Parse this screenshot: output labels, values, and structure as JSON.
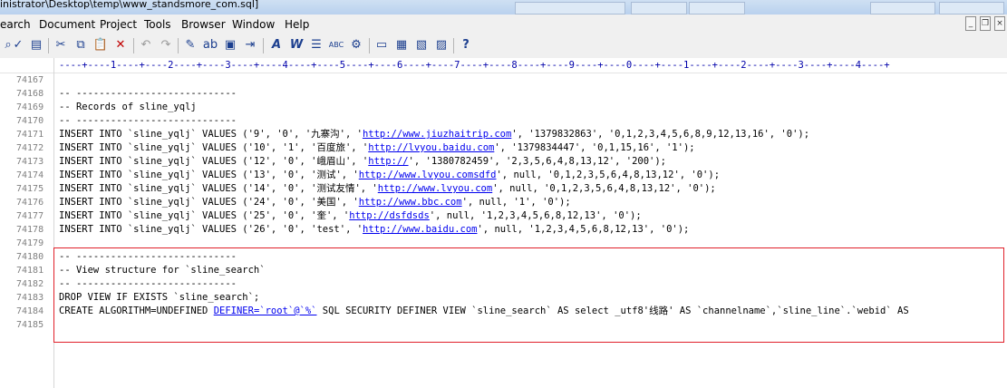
{
  "window": {
    "title": "inistrator\\Desktop\\temp\\www_standsmore_com.sql]"
  },
  "menu": [
    "earch",
    "Document",
    "Project",
    "Tools",
    "Browser",
    "Window",
    "Help"
  ],
  "toolbar": {
    "icons": [
      "search-icon",
      "spellcheck-icon",
      "reference-icon",
      "cut-icon",
      "copy-icon",
      "paste-icon",
      "delete-icon",
      "undo-icon",
      "redo-icon",
      "find-icon",
      "replace-icon",
      "find-in-files-icon",
      "code-list-icon",
      "format-italic-icon",
      "format-w-icon",
      "list-icon",
      "abc-icon",
      "tools-icon",
      "panel1-icon",
      "panel2-icon",
      "panel3-icon",
      "panel4-icon",
      "help-icon"
    ]
  },
  "editor": {
    "ruler": "----+----1----+----2----+----3----+----4----+----5----+----6----+----7----+----8----+----9----+----0----+----1----+----2----+----3----+----4----+",
    "lines": [
      {
        "num": "74167",
        "text": ""
      },
      {
        "num": "74168",
        "text": "-- ----------------------------"
      },
      {
        "num": "74169",
        "text": "-- Records of sline_yqlj"
      },
      {
        "num": "74170",
        "text": "-- ----------------------------"
      },
      {
        "num": "74171",
        "text": "INSERT INTO `sline_yqlj` VALUES ('9', '0', '九寨沟', '",
        "link": "http://www.jiuzhaitrip.com",
        "text2": "', '1379832863', '0,1,2,3,4,5,6,8,9,12,13,16', '0');"
      },
      {
        "num": "74172",
        "text": "INSERT INTO `sline_yqlj` VALUES ('10', '1', '百度旅', '",
        "link": "http://lvyou.baidu.com",
        "text2": "', '1379834447', '0,1,15,16', '1');"
      },
      {
        "num": "74173",
        "text": "INSERT INTO `sline_yqlj` VALUES ('12', '0', '峨眉山', '",
        "link": "http://",
        "text2": "', '1380782459', '2,3,5,6,4,8,13,12', '200');"
      },
      {
        "num": "74174",
        "text": "INSERT INTO `sline_yqlj` VALUES ('13', '0', '测试', '",
        "link": "http://www.lvyou.comsdfd",
        "text2": "', null, '0,1,2,3,5,6,4,8,13,12', '0');"
      },
      {
        "num": "74175",
        "text": "INSERT INTO `sline_yqlj` VALUES ('14', '0', '测试友情', '",
        "link": "http://www.lvyou.com",
        "text2": "', null, '0,1,2,3,5,6,4,8,13,12', '0');"
      },
      {
        "num": "74176",
        "text": "INSERT INTO `sline_yqlj` VALUES ('24', '0', '美国', '",
        "link": "http://www.bbc.com",
        "text2": "', null, '1', '0');"
      },
      {
        "num": "74177",
        "text": "INSERT INTO `sline_yqlj` VALUES ('25', '0', '奎', '",
        "link": "http://dsfdsds",
        "text2": "', null, '1,2,3,4,5,6,8,12,13', '0');"
      },
      {
        "num": "74178",
        "text": "INSERT INTO `sline_yqlj` VALUES ('26', '0', 'test', '",
        "link": "http://www.baidu.com",
        "text2": "', null, '1,2,3,4,5,6,8,12,13', '0');"
      },
      {
        "num": "74179",
        "text": ""
      },
      {
        "num": "74180",
        "text": "-- ----------------------------"
      },
      {
        "num": "74181",
        "text": "-- View structure for `sline_search`"
      },
      {
        "num": "74182",
        "text": "-- ----------------------------"
      },
      {
        "num": "74183",
        "text": "DROP VIEW IF EXISTS `sline_search`;"
      },
      {
        "num": "74184",
        "text": "CREATE ALGORITHM=UNDEFINED ",
        "link": "DEFINER=`root`@`%`",
        "text2": " SQL SECURITY DEFINER VIEW `sline_search` AS select _utf8'线路' AS `channelname`,`sline_line`.`webid` AS"
      },
      {
        "num": "74185",
        "text": ""
      }
    ]
  }
}
